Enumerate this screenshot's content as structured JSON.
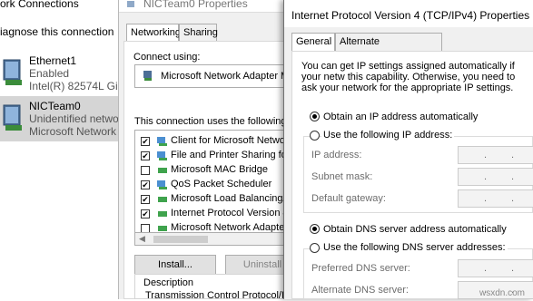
{
  "network_connections": {
    "title": "ork Connections",
    "toolbar_action": "iagnose this connection",
    "items": [
      {
        "name": "Ethernet1",
        "status": "Enabled",
        "device": "Intel(R) 82574L Giga"
      },
      {
        "name": "NICTeam0",
        "status": "Unidentified network",
        "device": "Microsoft Network A"
      }
    ]
  },
  "nic_properties": {
    "title": "NICTeam0 Properties",
    "tabs": [
      "Networking",
      "Sharing"
    ],
    "connect_using_label": "Connect using:",
    "adapter_name": "Microsoft Network Adapter Mult",
    "components_label": "This connection uses the following ite",
    "components": [
      {
        "label": "Client for Microsoft Networks",
        "checked": true
      },
      {
        "label": "File and Printer Sharing for M",
        "checked": true
      },
      {
        "label": "Microsoft MAC Bridge",
        "checked": false
      },
      {
        "label": "QoS Packet Scheduler",
        "checked": true
      },
      {
        "label": "Microsoft Load Balancing/Fa",
        "checked": true
      },
      {
        "label": "Internet Protocol Version 4 (T",
        "checked": true
      },
      {
        "label": "Microsoft Network Adapter M",
        "checked": false
      }
    ],
    "install_button": "Install...",
    "uninstall_button": "Uninstall",
    "description_label": "Description",
    "description_text": "Transmission Control Protocol/Inter"
  },
  "ipv4_properties": {
    "title": "Internet Protocol Version 4 (TCP/IPv4) Properties",
    "tabs": [
      "General",
      "Alternate Configuration"
    ],
    "info_text": "You can get IP settings assigned automatically if your netw this capability. Otherwise, you need to ask your network for the appropriate IP settings.",
    "ip_auto_label": "Obtain an IP address automatically",
    "ip_manual_label": "Use the following IP address:",
    "ip_address_label": "IP address:",
    "subnet_mask_label": "Subnet mask:",
    "default_gateway_label": "Default gateway:",
    "dns_auto_label": "Obtain DNS server address automatically",
    "dns_manual_label": "Use the following DNS server addresses:",
    "preferred_dns_label": "Preferred DNS server:",
    "alternate_dns_label": "Alternate DNS server:",
    "ip_mode": "automatic",
    "dns_mode": "automatic"
  },
  "watermark": "wsxdn.com"
}
